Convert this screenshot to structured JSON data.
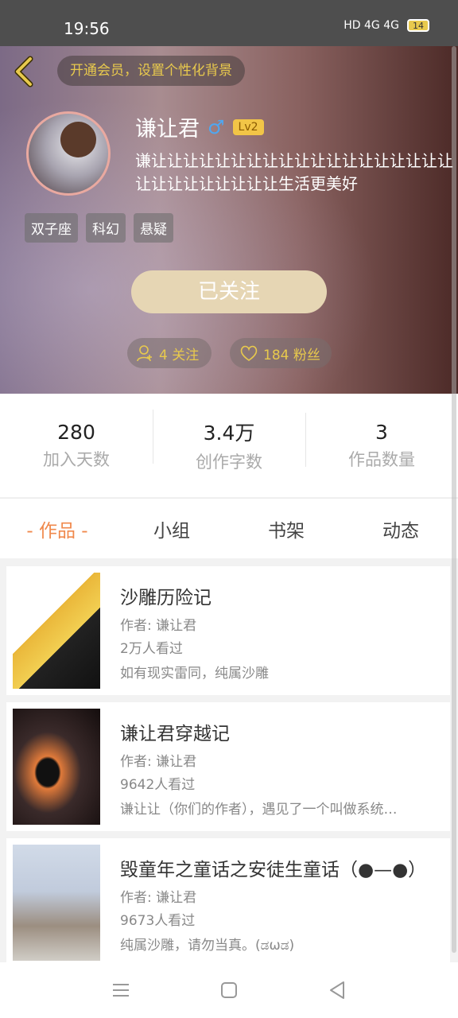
{
  "status_bar": {
    "time": "19:56",
    "indicators": "HD 4G 4G",
    "battery": "14"
  },
  "header": {
    "vip_promo": "开通会员，设置个性化背景"
  },
  "profile": {
    "name": "谦让君",
    "level": "Lv2",
    "bio": "谦让让让让让让让让让让让让让让让让让让让让让让让让让让让让生活更美好",
    "tags": [
      "双子座",
      "科幻",
      "悬疑"
    ],
    "follow_state": "已关注",
    "following": "4 关注",
    "fans": "184 粉丝"
  },
  "stats": [
    {
      "value": "280",
      "label": "加入天数"
    },
    {
      "value": "3.4万",
      "label": "创作字数"
    },
    {
      "value": "3",
      "label": "作品数量"
    }
  ],
  "tabs": [
    "- 作品 -",
    "小组",
    "书架",
    "动态"
  ],
  "works": [
    {
      "title": "沙雕历险记",
      "author": "作者: 谦让君",
      "views": "2万人看过",
      "desc": "如有现实雷同，纯属沙雕"
    },
    {
      "title": "谦让君穿越记",
      "author": "作者: 谦让君",
      "views": "9642人看过",
      "desc": "谦让让（你们的作者），遇见了一个叫做系统…"
    },
    {
      "title": "毁童年之童话之安徒生童话（●—●）",
      "author": "作者: 谦让君",
      "views": "9673人看过",
      "desc": "纯属沙雕，请勿当真。(ಡωಡ)"
    }
  ],
  "colors": {
    "accent": "#f0894c",
    "gold": "#e8c94d",
    "follow_button": "#e6d6b4"
  }
}
